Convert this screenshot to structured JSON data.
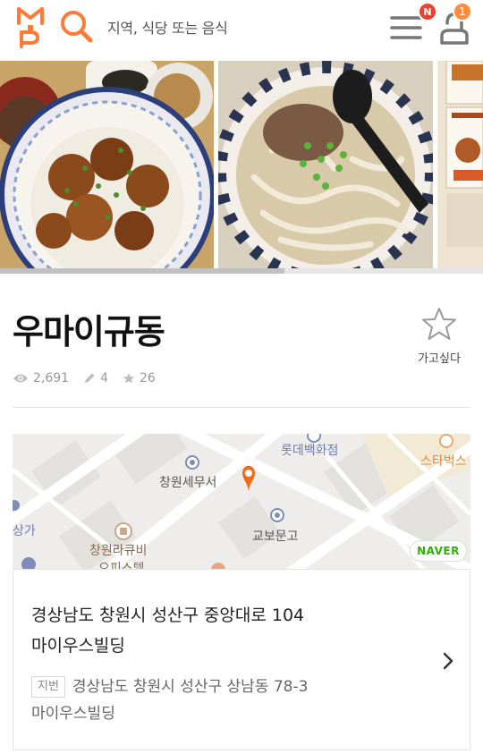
{
  "header": {
    "search_placeholder": "지역, 식당 또는 음식",
    "menu_badge": "N",
    "user_badge": "1",
    "colors": {
      "brand": "#ff7a36",
      "gray_icon": "#777777"
    }
  },
  "photos": [
    {
      "alt": "fried chicken rice bowl"
    },
    {
      "alt": "beef udon"
    },
    {
      "alt": "menu board"
    }
  ],
  "restaurant": {
    "name": "우마이규동",
    "wish_label": "가고싶다",
    "stats": {
      "views": "2,691",
      "reviews": "4",
      "wishes": "26"
    }
  },
  "map": {
    "labels": {
      "lotte": "롯데백화점",
      "starbucks": "스타벅스",
      "changwon_tax": "창원세무서",
      "kyobo": "교보문고",
      "sangga": "상가",
      "lacubi": "창원라큐비",
      "officetel": "오피스텔"
    },
    "naver": "NAVER"
  },
  "address": {
    "road_line1": "경상남도 창원시 성산구 중앙대로 104",
    "road_line2": "마이우스빌딩",
    "jibun_tag": "지번",
    "jibun_line1": "경상남도 창원시 성산구 상남동 78-3",
    "jibun_line2": "마이우스빌딩"
  }
}
